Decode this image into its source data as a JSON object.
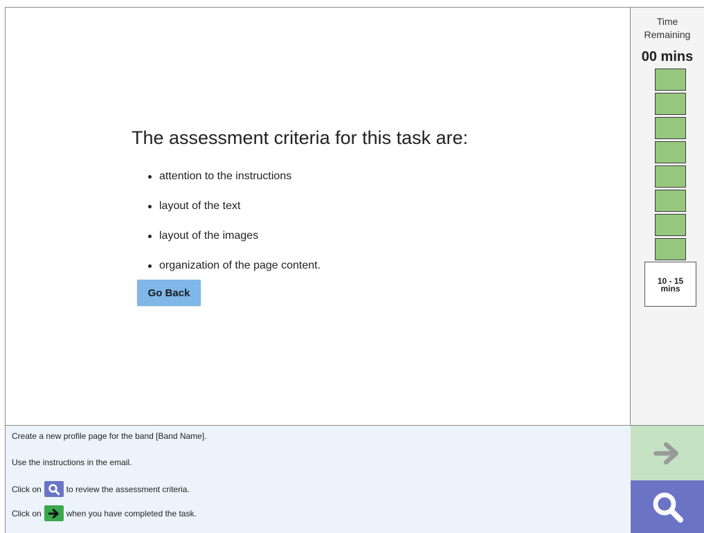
{
  "main": {
    "title": "The assessment criteria for this task are:",
    "criteria": [
      "attention to the instructions",
      "layout of the text",
      "layout of the images",
      "organization of the page content."
    ],
    "go_back_label": "Go Back"
  },
  "timer": {
    "label_line1": "Time",
    "label_line2": "Remaining",
    "value": "00 mins",
    "blocks": 8,
    "block_color": "#96c77e",
    "range_line1": "10 - 15",
    "range_line2": "mins"
  },
  "instructions": {
    "line1": "Create a new profile page for the band [Band Name].",
    "line2": "Use the instructions in the email.",
    "line3_prefix": "Click on",
    "line3_suffix": "to review the assessment criteria.",
    "line4_prefix": "Click on",
    "line4_suffix": "when you have completed the task."
  },
  "icons": {
    "search": "search-icon",
    "next": "arrow-right-icon"
  },
  "colors": {
    "search_bg": "#6b74c4",
    "next_bg": "#c5e2c2",
    "inline_next_bg": "#3aa84c",
    "go_back_bg": "#7fb7e8",
    "instructions_bg": "#edf3fb"
  }
}
